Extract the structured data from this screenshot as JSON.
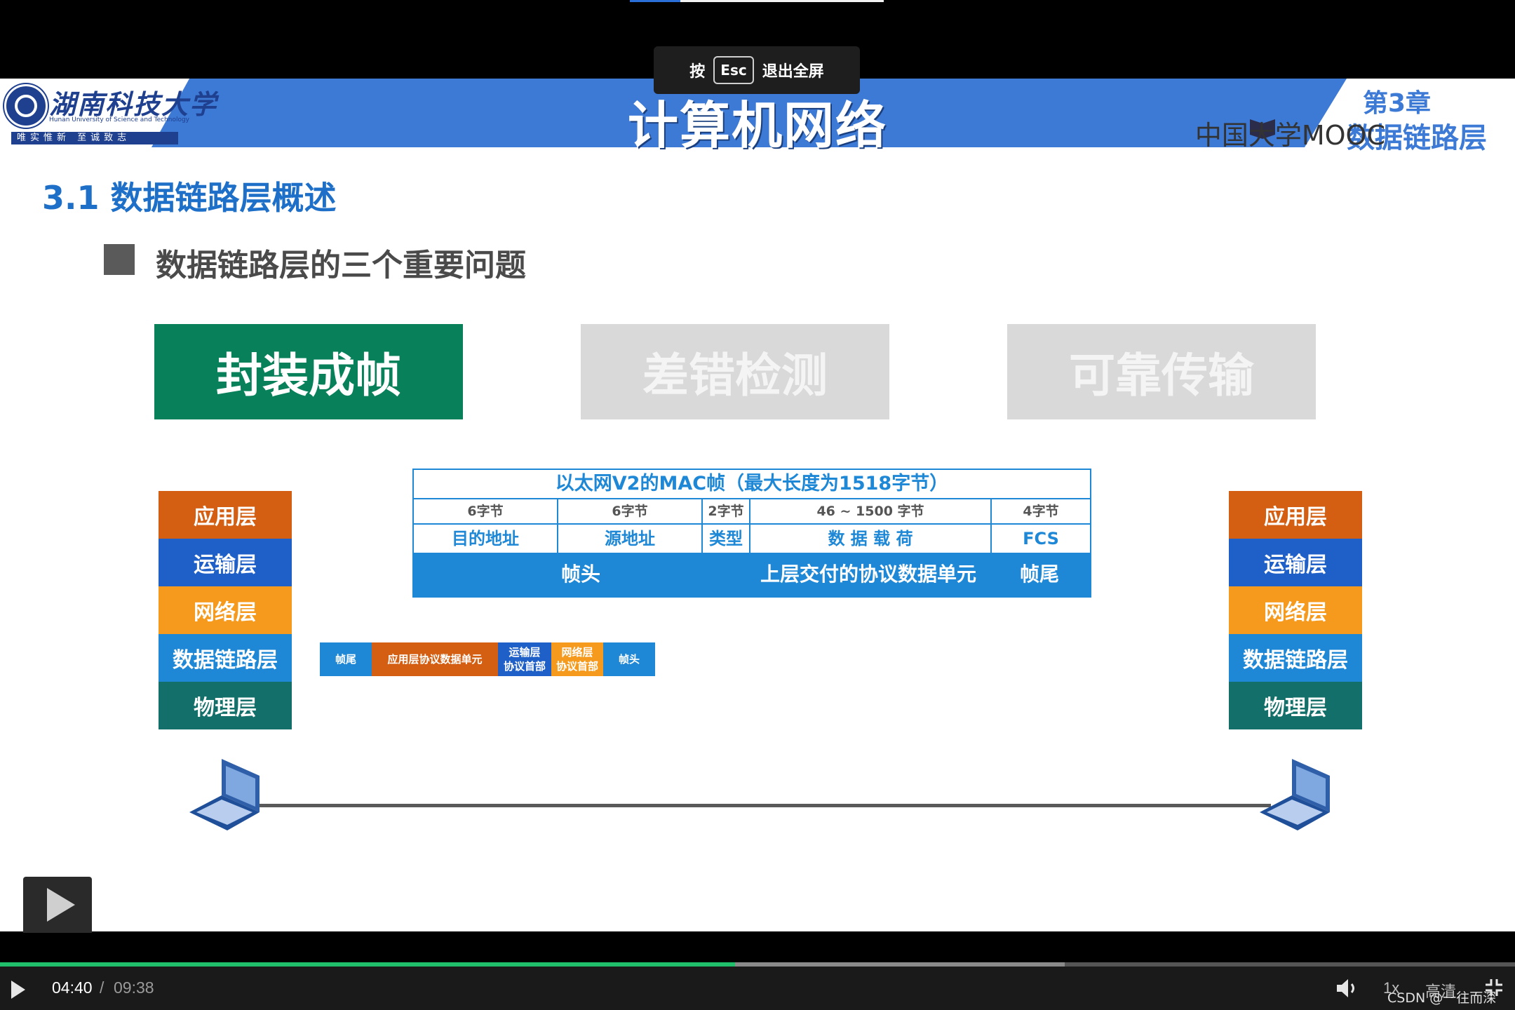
{
  "esc_toast": {
    "prefix": "按",
    "key": "Esc",
    "suffix": "退出全屏"
  },
  "slide": {
    "university": {
      "name": "湖南科技大学",
      "english": "Hunan University of Science and Technology",
      "motto": "唯实惟新  至诚致志"
    },
    "course_title": "计算机网络",
    "chapter_label": "第3章",
    "chapter_name": "数据链路层",
    "mooc_text": "中国大学MOOC",
    "section_title": "3.1 数据链路层概述",
    "bullet": "数据链路层的三个重要问题",
    "topics": [
      "封装成帧",
      "差错检测",
      "可靠传输"
    ],
    "stack_left": [
      "应用层",
      "运输层",
      "网络层",
      "数据链路层",
      "物理层"
    ],
    "stack_right": [
      "应用层",
      "运输层",
      "网络层",
      "数据链路层",
      "物理层"
    ],
    "stack_colors": [
      "#d45f12",
      "#1f5fc8",
      "#f59a1d",
      "#1e88d6",
      "#136f6a"
    ],
    "mac_frame": {
      "title": "以太网V2的MAC帧（最大长度为1518字节）",
      "sizes": [
        "6字节",
        "6字节",
        "2字节",
        "46 ~ 1500 字节",
        "4字节"
      ],
      "fields": [
        "目的地址",
        "源地址",
        "类型",
        "数 据 载 荷",
        "FCS"
      ],
      "band": {
        "header": "帧头",
        "payload": "上层交付的协议数据单元",
        "trailer": "帧尾"
      }
    },
    "strip": [
      {
        "line1": "帧尾",
        "line2": ""
      },
      {
        "line1": "应用层协议数据单元",
        "line2": ""
      },
      {
        "line1": "运输层",
        "line2": "协议首部"
      },
      {
        "line1": "网络层",
        "line2": "协议首部"
      },
      {
        "line1": "帧头",
        "line2": ""
      }
    ]
  },
  "player": {
    "progress_fraction": 0.485,
    "buffered_fraction": 0.703,
    "time_current": "04:40",
    "time_separator": "/",
    "time_total": "09:38",
    "speed": "1x",
    "quality": "高清",
    "watermark": "CSDN @一往而深"
  }
}
